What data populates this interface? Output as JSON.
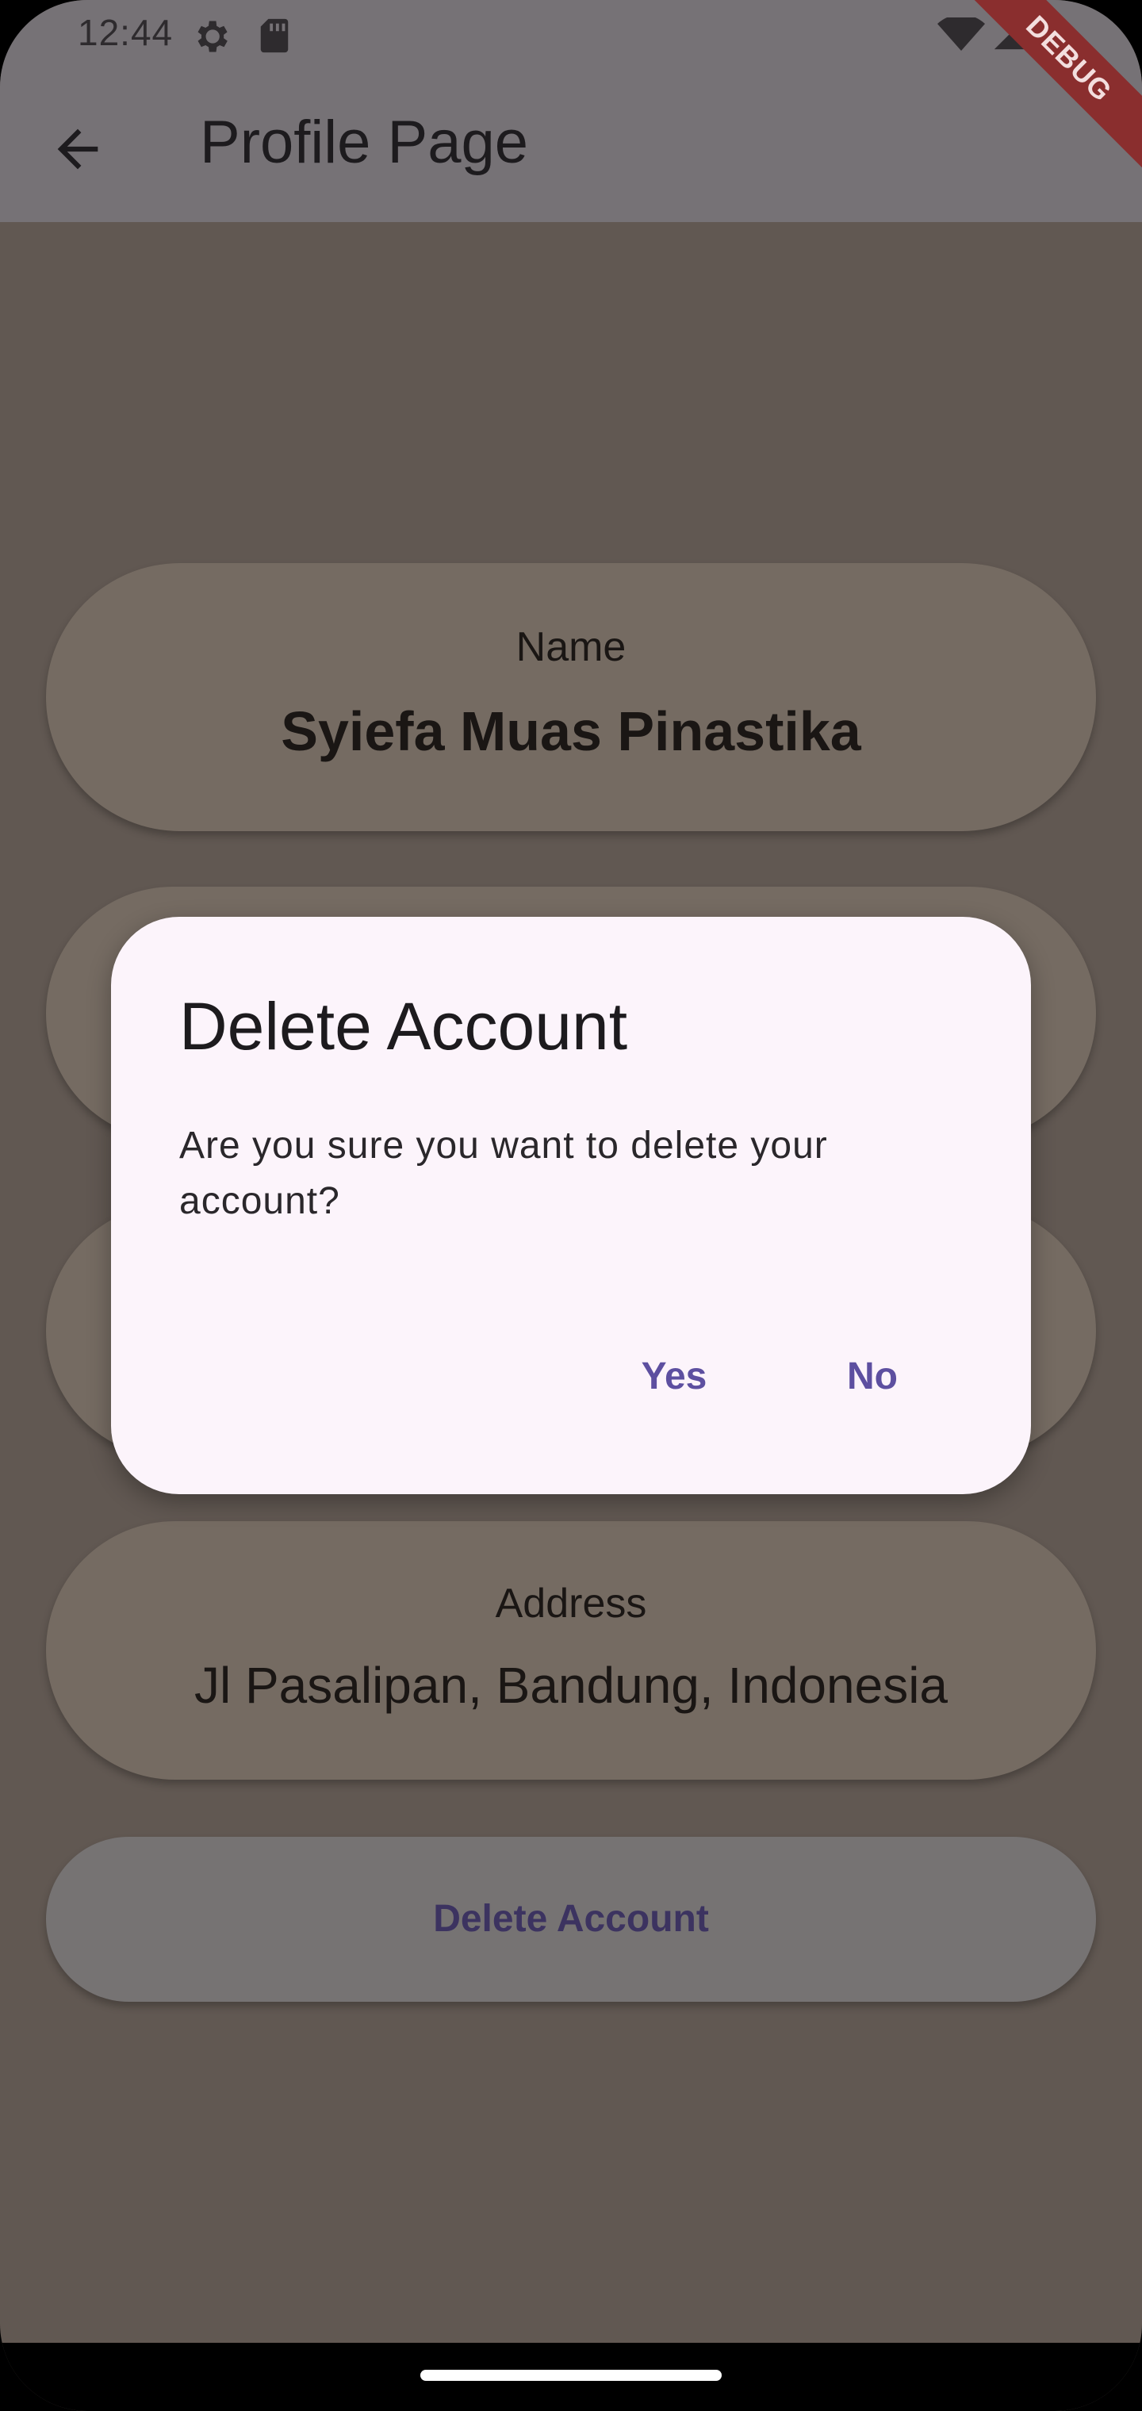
{
  "status_bar": {
    "time": "12:44",
    "icons": [
      "gear-icon",
      "sd-card-icon",
      "wifi-icon",
      "signal-icon"
    ]
  },
  "debug_banner": "DEBUG",
  "app_bar": {
    "title": "Profile Page",
    "back_icon": "arrow-back-icon"
  },
  "profile": {
    "name_label": "Name",
    "name_value": "Syiefa Muas Pinastika",
    "address_label": "Address",
    "address_value": "Jl Pasalipan, Bandung, Indonesia"
  },
  "delete_button_label": "Delete Account",
  "dialog": {
    "title": "Delete Account",
    "message": "Are you sure you want to delete your account?",
    "yes_label": "Yes",
    "no_label": "No"
  },
  "colors": {
    "scrim_background": "#615852",
    "app_bar": "#767276",
    "card": "#756b62",
    "dialog_background": "#fcf4fb",
    "accent": "#5d4fa0",
    "debug_ribbon": "#8a2e2e"
  }
}
